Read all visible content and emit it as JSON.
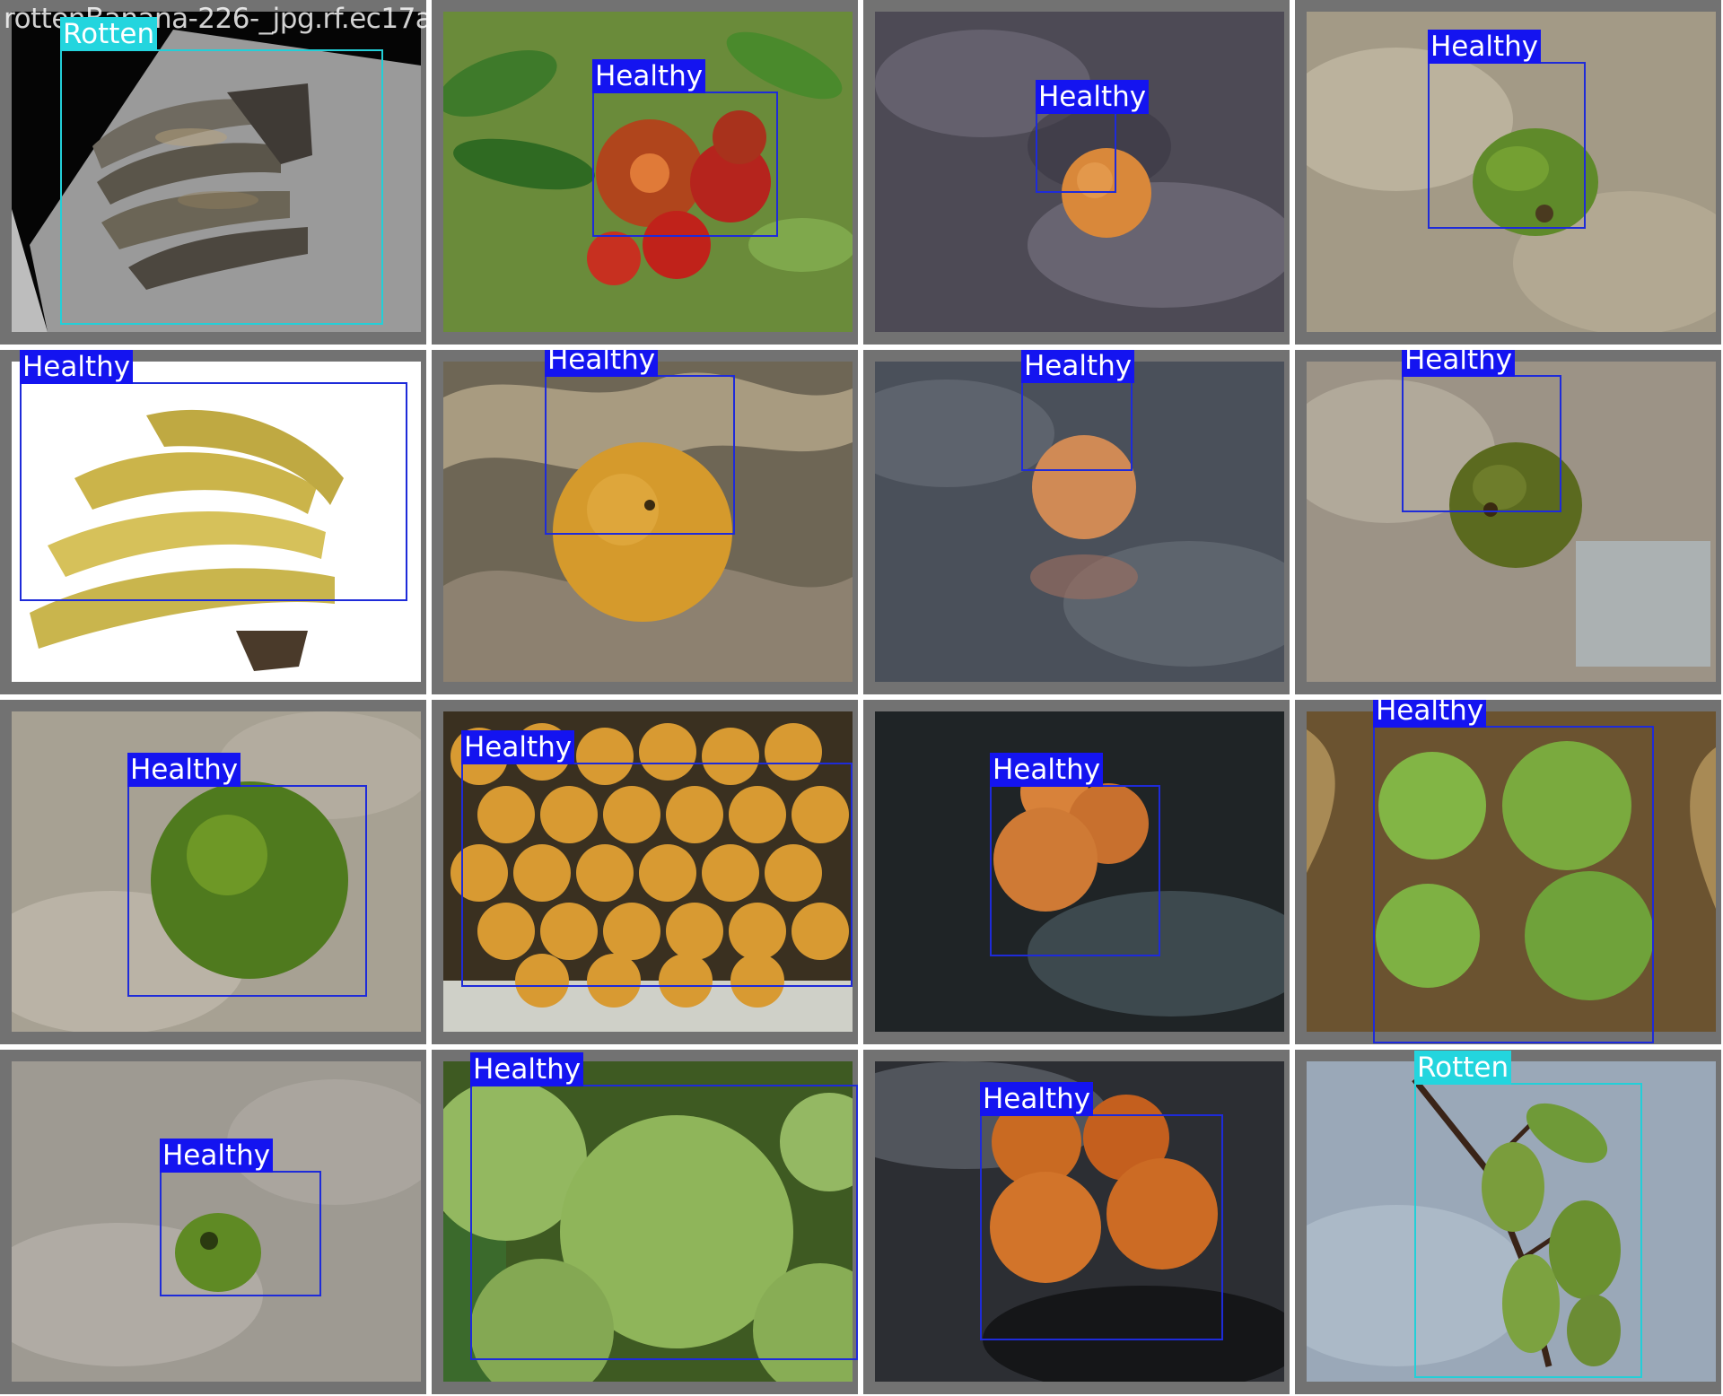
{
  "tiles": [
    {
      "filename": "rottenBanana-226-_jpg.rf.ec17a2dee35c88ecpg.rf.54b85516d813BXlfb2024028_174242329-POIRTR_0460_jpg.rf.2f258fa94cf8c",
      "label": "Rotten",
      "scene": "rotten-banana"
    },
    {
      "filename": "IMG_20210428_ebe",
      "label": "Healthy",
      "scene": "pomegranate"
    },
    {
      "filename": "PXL_20210428_174242329-PORTRAIT",
      "label": "Healthy",
      "scene": "orange-single"
    },
    {
      "filename": "IMG_0460_jpg.rf.2f258fa94cf8c",
      "label": "Healthy",
      "scene": "guava-single"
    },
    {
      "filename": "yellow-clip_Screen-Shot-2018-06-12-at",
      "label": "Healthy",
      "scene": "yellow-banana"
    },
    {
      "filename": "Orange-18-_jpg.rf.aabd6a369bb8b5fa2c5a528",
      "label": "Healthy",
      "scene": "orange-carved"
    },
    {
      "filename": "PXL_20210428_174329019-PORTRAIT_jpg.rf.5253b725b8e",
      "label": "Healthy",
      "scene": "orange-dark"
    },
    {
      "filename": "IMG_0703_jpg.rf.5253b725b8e",
      "label": "Healthy",
      "scene": "guava-dark"
    },
    {
      "filename": "IMG_0605_jpg.rf.5040adad510204a62335163",
      "label": "Healthy",
      "scene": "lime"
    },
    {
      "filename": "image635_jpg.rf.dfc8032e1ab47a7d02494",
      "label": "Healthy",
      "scene": "orange-pile"
    },
    {
      "filename": "PXL_20210428_175030272_jpg",
      "label": "Healthy",
      "scene": "orange-three"
    },
    {
      "filename": "IMG_0792_jpg.rf.3a2a0f802c56",
      "label": "Healthy",
      "scene": "guava-plate"
    },
    {
      "filename": "IMG_0461_jpg.rf.ec78093d8fa64d3e7e7ejpg.rf.c89d5d2c5f15",
      "label": "Healthy",
      "scene": "guava-small"
    },
    {
      "filename": "IMG_guava_7p4_jpg.rf.c89d5d2c5f15",
      "label": "Healthy",
      "scene": "guava-closeup"
    },
    {
      "filename": "PXL_20210428_175026019_jpg",
      "label": "Healthy",
      "scene": "orange-four"
    },
    {
      "filename": "RottenBG1-32-_jpg.rf.141ff9",
      "label": "Rotten",
      "scene": "rotten-grapes"
    }
  ],
  "colors": {
    "healthy_box": "#1E2BD9",
    "healthy_tag": "#1414F0",
    "rotten_box": "#23CFD8",
    "rotten_tag": "#23D5DE",
    "tile_border": "#727272"
  }
}
